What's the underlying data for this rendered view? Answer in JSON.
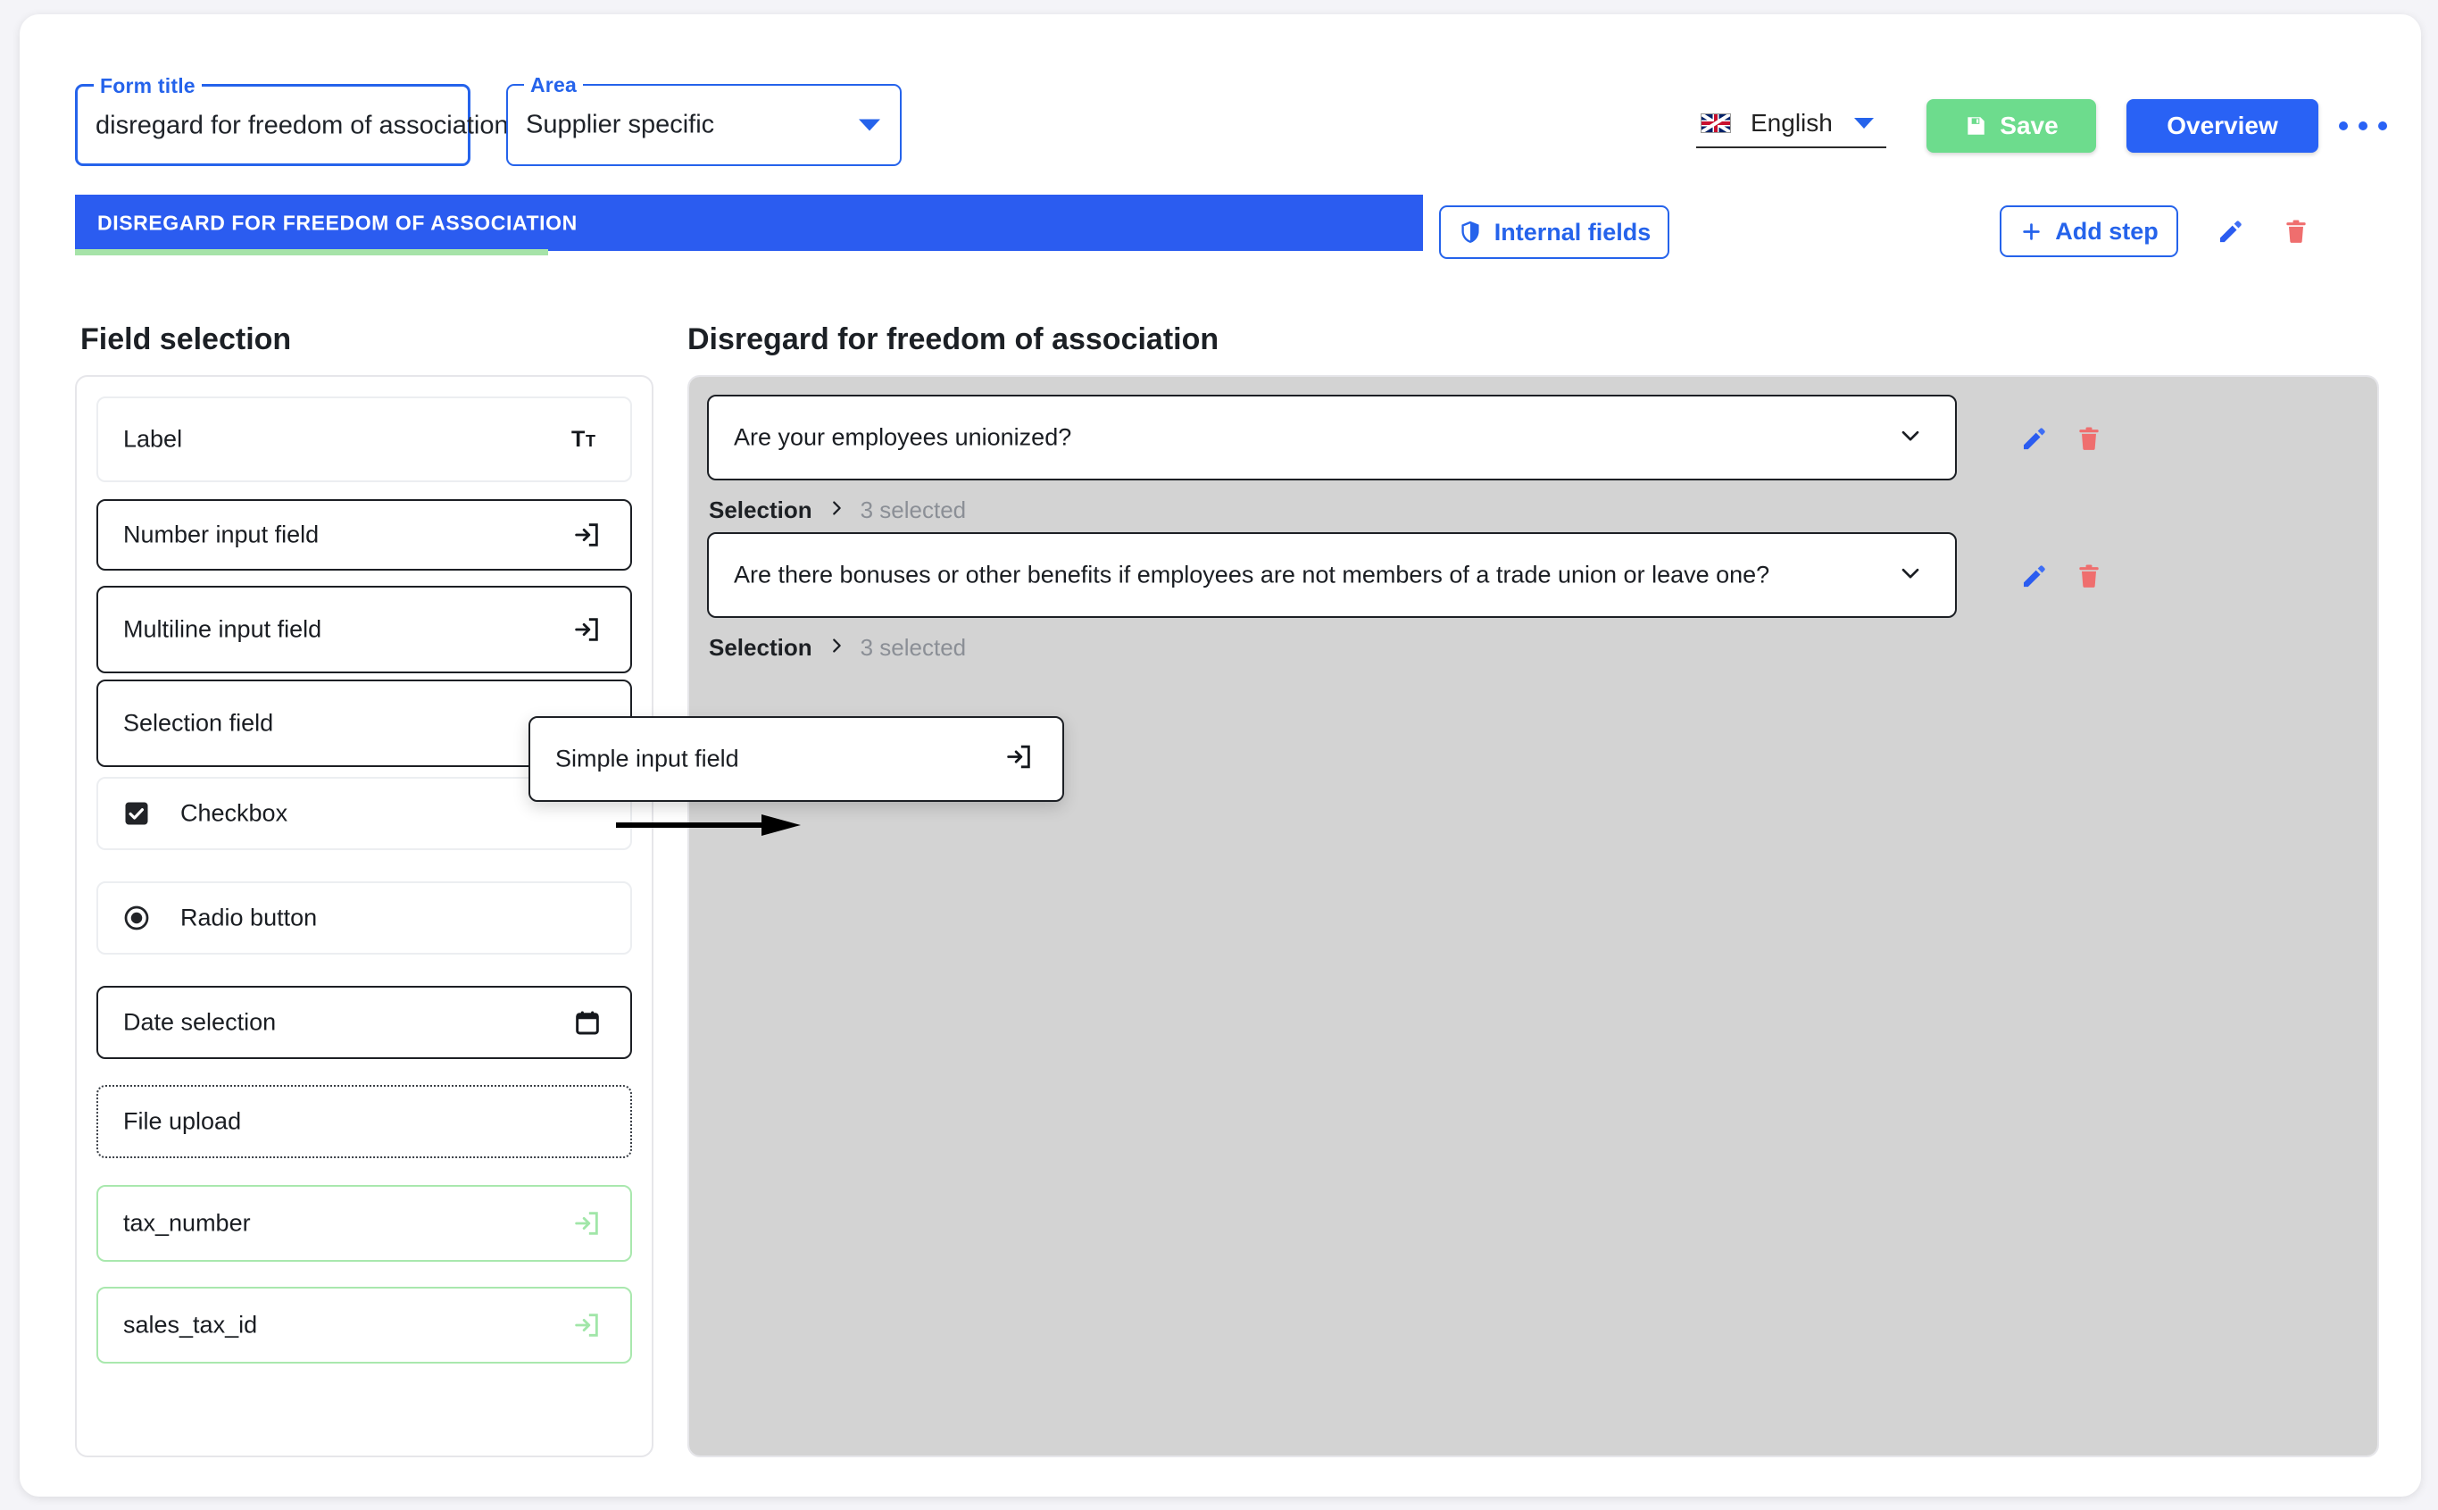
{
  "header": {
    "form_title": {
      "legend": "Form title",
      "value": "disregard for freedom of association"
    },
    "area": {
      "legend": "Area",
      "value": "Supplier specific",
      "caret_icon": "chevron-down-icon"
    },
    "language": {
      "value": "English",
      "flag_icon": "uk-flag-icon",
      "caret_icon": "chevron-down-icon"
    },
    "save_label": "Save",
    "save_icon": "floppy-save-icon",
    "overview_label": "Overview",
    "more_icon": "ellipsis-icon"
  },
  "stepbar": {
    "active_step_label": "DISREGARD FOR FREEDOM OF ASSOCIATION",
    "internal_fields_label": "Internal fields",
    "internal_fields_icon": "shield-icon",
    "add_step_label": "Add step",
    "add_step_icon": "plus-icon",
    "edit_icon": "pencil-icon",
    "delete_icon": "trash-icon"
  },
  "field_selection": {
    "title": "Field selection",
    "items": [
      {
        "label": "Label",
        "icon": "text-size-icon",
        "border": "light",
        "icon_side": "right"
      },
      {
        "label": "Number input field",
        "icon": "input-arrow-icon",
        "border": "dark",
        "icon_side": "right"
      },
      {
        "label": "Multiline input field",
        "icon": "input-arrow-icon",
        "border": "dark",
        "icon_side": "right"
      },
      {
        "label": "Selection field",
        "icon": "none",
        "border": "dark",
        "icon_side": "none"
      },
      {
        "label": "Checkbox",
        "icon": "checkbox-checked-icon",
        "border": "light",
        "icon_side": "left"
      },
      {
        "label": "Radio button",
        "icon": "radio-selected-icon",
        "border": "light",
        "icon_side": "left"
      },
      {
        "label": "Date selection",
        "icon": "calendar-icon",
        "border": "dark",
        "icon_side": "right"
      },
      {
        "label": "File upload",
        "icon": "none",
        "border": "dotted",
        "icon_side": "none"
      },
      {
        "label": "tax_number",
        "icon": "input-arrow-icon",
        "border": "green",
        "icon_side": "right"
      },
      {
        "label": "sales_tax_id",
        "icon": "input-arrow-icon",
        "border": "green",
        "icon_side": "right"
      }
    ]
  },
  "step_content": {
    "title": "Disregard for freedom of association",
    "questions": [
      {
        "text": "Are your employees unionized?",
        "chevron_icon": "chevron-down-icon",
        "meta_key": "Selection",
        "meta_separator_icon": "chevron-right-icon",
        "meta_value": "3 selected",
        "edit_icon": "pencil-icon",
        "delete_icon": "trash-icon"
      },
      {
        "text": "Are there bonuses or other benefits if employees are not members of a trade union or leave one?",
        "chevron_icon": "chevron-down-icon",
        "meta_key": "Selection",
        "meta_separator_icon": "chevron-right-icon",
        "meta_value": "3 selected",
        "edit_icon": "pencil-icon",
        "delete_icon": "trash-icon"
      }
    ]
  },
  "drag_ghost": {
    "label": "Simple input field",
    "icon": "input-arrow-icon",
    "arrow_icon": "arrow-right-icon"
  },
  "colors": {
    "primary_blue": "#2563eb",
    "step_blue": "#2b5cf0",
    "overview_blue": "#2962f5",
    "save_green": "#6ddc8d",
    "progress_green": "#a6e3a8",
    "field_green": "#a9e8ae",
    "danger_red": "#ef6e6e",
    "drop_gray": "#d3d3d3",
    "page_bg": "#f4f4f8"
  }
}
